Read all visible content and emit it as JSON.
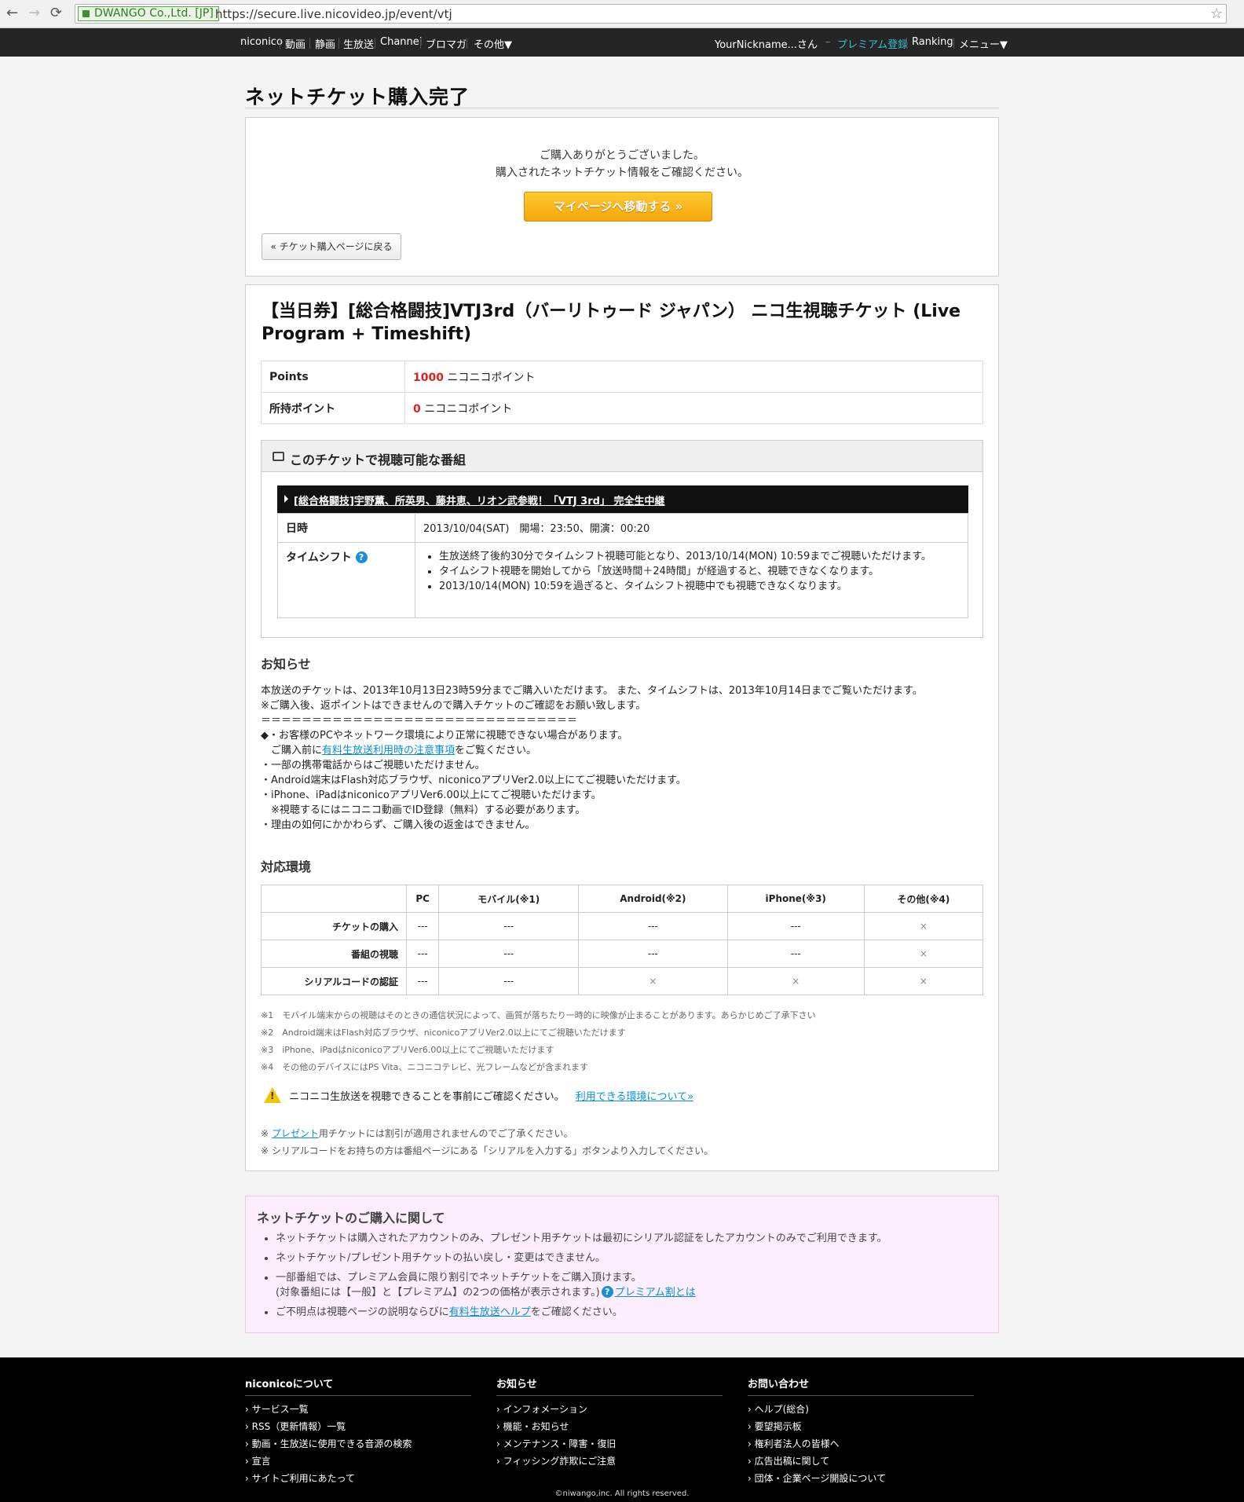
{
  "browser": {
    "back": "←",
    "forward": "→",
    "reload": "⟳",
    "ev_label": "DWANGO Co.,Ltd. [JP]",
    "url": "https://secure.live.nicovideo.jp/event/vtj",
    "star": "☆"
  },
  "topnav": {
    "left": [
      "niconico",
      "動画",
      "静画",
      "生放送",
      "Channel",
      "ブロマガ",
      "その他▼"
    ],
    "nickname": "YourNickname...さん",
    "dash": "–",
    "premium": "プレミアム登録",
    "ranking": "Ranking",
    "menu": "メニュー▼"
  },
  "page_title": "ネットチケット購入完了",
  "confirm": {
    "line1": "ご購入ありがとうございました。",
    "line2": "購入されたネットチケット情報をご確認ください。",
    "mypage_button": "マイページへ移動する »",
    "back_button": "« チケット購入ページに戻る"
  },
  "ticket": {
    "title": "【当日券】[総合格闘技]VTJ3rd（バーリトゥード ジャパン） ニコ生視聴チケット (Live Program + Timeshift)",
    "points_label": "Points",
    "points_value": "1000",
    "points_unit": "ニコニコポイント",
    "owned_label": "所持ポイント",
    "owned_value": "0",
    "owned_unit": "ニコニコポイント"
  },
  "programs": {
    "heading": "このチケットで視聴可能な番組",
    "program_title": "[総合格闘技]宇野薫、所英男、藤井恵、リオン武参戦！「VTJ 3rd」 完全生中継",
    "datetime_label": "日時",
    "datetime_value": "2013/10/04(SAT)　開場：23:50、開演：00:20",
    "timeshift_label": "タイムシフト",
    "timeshift_items": [
      "生放送終了後約30分でタイムシフト視聴可能となり、2013/10/14(MON) 10:59までご視聴いただけます。",
      "タイムシフト視聴を開始してから「放送時間＋24時間」が経過すると、視聴できなくなります。",
      "2013/10/14(MON) 10:59を過ぎると、タイムシフト視聴中でも視聴できなくなります。"
    ]
  },
  "notice": {
    "heading": "お知らせ",
    "line1": "本放送のチケットは、2013年10月13日23時59分までご購入いただけます。 また、タイムシフトは、2013年10月14日までご覧いただけます。",
    "line2": "※ご購入後、返ポイントはできませんので購入チケットのご確認をお願い致します。",
    "line3": "＝＝＝＝＝＝＝＝＝＝＝＝＝＝＝＝＝＝＝＝＝＝＝＝＝＝＝＝＝＝＝",
    "line4": "◆・お客様のPCやネットワーク環境により正常に視聴できない場合があります。",
    "line5_pre": "　ご購入前に",
    "line5_link": "有料生放送利用時の注意事項",
    "line5_post": "をご覧ください。",
    "line6": "・一部の携帯電話からはご視聴いただけません。",
    "line7": "・Android端末はFlash対応ブラウザ、niconicoアプリVer2.0以上にてご視聴いただけます。",
    "line8": "・iPhone、iPadはniconicoアプリVer6.00以上にてご視聴いただけます。",
    "line9": "　※視聴するにはニコニコ動画でID登録（無料）する必要があります。",
    "line10": "・理由の如何にかかわらず、ご購入後の返金はできません。"
  },
  "environment": {
    "heading": "対応環境",
    "columns": [
      "",
      "PC",
      "モバイル(※1)",
      "Android(※2)",
      "iPhone(※3)",
      "その他(※4)"
    ],
    "rows": [
      {
        "label": "チケットの購入",
        "cells": [
          "---",
          "---",
          "---",
          "---",
          "×"
        ]
      },
      {
        "label": "番組の視聴",
        "cells": [
          "---",
          "---",
          "---",
          "---",
          "×"
        ]
      },
      {
        "label": "シリアルコードの認証",
        "cells": [
          "---",
          "---",
          "×",
          "×",
          "×"
        ]
      }
    ],
    "notes": [
      "※1　モバイル端末からの視聴はそのときの通信状況によって、画質が落ちたり一時的に映像が止まることがあります。あらかじめご了承下さい",
      "※2　Android端末はFlash対応ブラウザ、niconicoアプリVer2.0以上にてご視聴いただけます",
      "※3　iPhone、iPadはniconicoアプリVer6.00以上にてご視聴いただけます",
      "※4　その他のデバイスにはPS Vita、ニコニコテレビ、光フレームなどが含まれます"
    ],
    "warning_text": "ニコニコ生放送を視聴できることを事前にご確認ください。",
    "warning_link": "利用できる環境について»",
    "small1_pre": "※ ",
    "small1_link": "プレゼント",
    "small1_post": "用チケットには割引が適用されませんのでご了承ください。",
    "small2": "※ シリアルコードをお持ちの方は番組ページにある「シリアルを入力する」ボタンより入力してください。"
  },
  "purchase_info": {
    "heading": "ネットチケットのご購入に関して",
    "item1": "ネットチケットは購入されたアカウントのみ、プレゼント用チケットは最初にシリアル認証をしたアカウントのみでご利用できます。",
    "item2": "ネットチケット/プレゼント用チケットの払い戻し・変更はできません。",
    "item3a": "一部番組では、プレミアム会員に限り割引でネットチケットをご購入頂けます。",
    "item3b": "(対象番組には【一般】と【プレミアム】の2つの価格が表示されます。)",
    "item3_link": "プレミアム割とは",
    "item4_pre": "ご不明点は視聴ページの説明ならびに",
    "item4_link": "有料生放送ヘルプ",
    "item4_post": "をご確認ください。"
  },
  "footer": {
    "col1": {
      "heading": "niconicoについて",
      "links": [
        "サービス一覧",
        "RSS（更新情報）一覧",
        "動画・生放送に使用できる音源の検索",
        "宣言",
        "サイトご利用にあたって"
      ]
    },
    "col2": {
      "heading": "お知らせ",
      "links": [
        "インフォメーション",
        "機能・お知らせ",
        "メンテナンス・障害・復旧",
        "フィッシング詐欺にご注意"
      ]
    },
    "col3": {
      "heading": "お問い合わせ",
      "links": [
        "ヘルプ(総合)",
        "要望掲示板",
        "権利者法人の皆様へ",
        "広告出稿に関して",
        "団体・企業ページ開設について"
      ]
    },
    "copyright": "©niwango,inc. All rights reserved."
  }
}
